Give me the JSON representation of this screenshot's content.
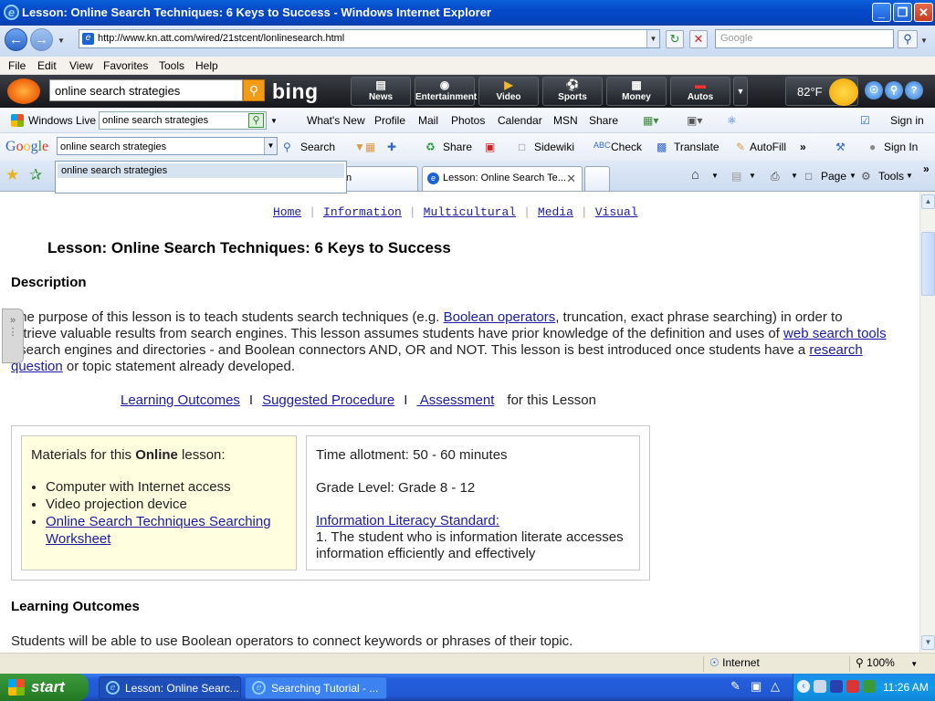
{
  "window": {
    "title": "Lesson: Online Search Techniques: 6 Keys to Success - Windows Internet Explorer",
    "minimize": "_",
    "maximize": "❐",
    "close": "✕"
  },
  "navbar": {
    "url": "http://www.kn.att.com/wired/21stcent/lonlinesearch.html",
    "search_placeholder": "Google"
  },
  "menu": [
    "File",
    "Edit",
    "View",
    "Favorites",
    "Tools",
    "Help"
  ],
  "bing": {
    "query": "online search strategies",
    "logo": "bing",
    "tabs": [
      "News",
      "Entertainment",
      "Video",
      "Sports",
      "Money",
      "Autos"
    ],
    "temperature": "82°F"
  },
  "windows_live": {
    "label": "Windows Live",
    "query": "online search strategies",
    "links": [
      "What's New",
      "Profile",
      "Mail",
      "Photos",
      "Calendar",
      "MSN",
      "Share"
    ],
    "sign_in": "Sign in"
  },
  "google_bar": {
    "query": "online search strategies",
    "suggestion": "online search strategies",
    "items": [
      "Search",
      "Share",
      "Sidewiki",
      "Check",
      "Translate",
      "AutoFill"
    ],
    "sign_in": "Sign In"
  },
  "tabs": {
    "inactive_tail": "n",
    "active": "Lesson: Online Search Te...",
    "page_label": "Page",
    "tools_label": "Tools"
  },
  "page": {
    "nav": [
      "Home",
      "Information",
      "Multicultural",
      "Media",
      "Visual"
    ],
    "title": "Lesson: Online Search Techniques: 6 Keys to Success",
    "description_heading": "Description",
    "desc_1": "The purpose of this lesson is to teach students search techniques (e.g. ",
    "desc_link_1": "Boolean operators",
    "desc_2": ", truncation, exact phrase searching) in order to retrieve valuable results from search engines. This lesson assumes students have prior knowledge of the definition and uses of ",
    "desc_link_2": "web search tools",
    "desc_3": " - search engines and directories - and Boolean connectors AND, OR and NOT. This lesson is best introduced once students have a ",
    "desc_link_3": "research question",
    "desc_4": " or topic statement already developed.",
    "jump_links": [
      "Learning Outcomes",
      "Suggested Procedure",
      " Assessment"
    ],
    "jump_suffix": "for this Lesson",
    "materials_prefix": "Materials for this ",
    "materials_bold": "Online",
    "materials_suffix": " lesson:",
    "materials": [
      "Computer with Internet access",
      "Video projection device"
    ],
    "materials_link": "Online Search Techniques Searching Worksheet",
    "time_allotment": "Time allotment: 50 - 60 minutes",
    "grade_level": "Grade Level: Grade 8 - 12",
    "standard_link": "Information Literacy Standard:",
    "standard_text": "1. The student who is information literate accesses information efficiently and effectively",
    "outcomes_heading": "Learning Outcomes",
    "outcomes_text": "Students will be able to use Boolean operators to connect keywords or phrases of their topic."
  },
  "status": {
    "zone": "Internet",
    "zoom": "100%"
  },
  "taskbar": {
    "start": "start",
    "tasks": [
      "Lesson: Online Searc...",
      "Searching Tutorial - ..."
    ],
    "clock": "11:26 AM"
  },
  "colors": {
    "link": "#1a1aa6",
    "materials_bg": "#ffffe0",
    "titlebar": "#0548c9"
  }
}
